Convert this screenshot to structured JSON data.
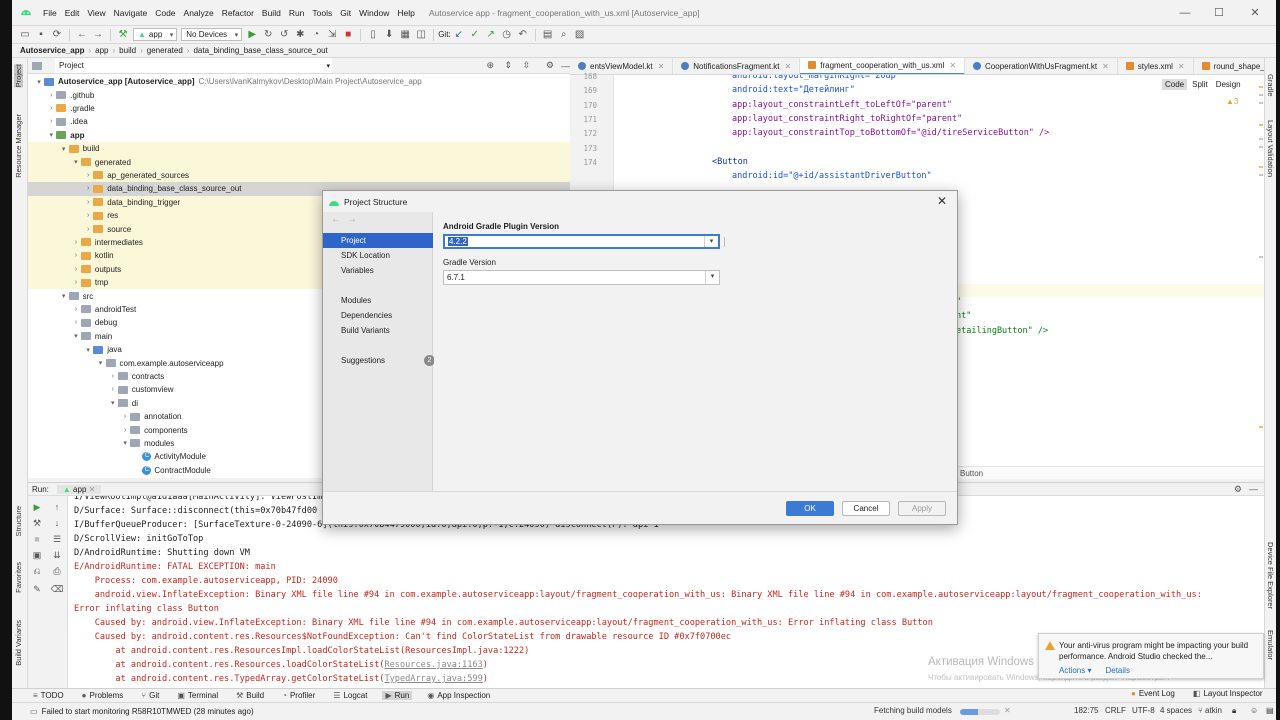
{
  "window": {
    "title": "Autoservice app - fragment_cooperation_with_us.xml [Autoservice_app]",
    "menu": [
      "File",
      "Edit",
      "View",
      "Navigate",
      "Code",
      "Analyze",
      "Refactor",
      "Build",
      "Run",
      "Tools",
      "Git",
      "Window",
      "Help"
    ]
  },
  "toolbar": {
    "run_config": "app",
    "device": "No Devices",
    "git_label": "Git:"
  },
  "breadcrumb": [
    "Autoservice_app",
    "app",
    "build",
    "generated",
    "data_binding_base_class_source_out"
  ],
  "left_strip": {
    "tabs": [
      "Project",
      "Resource Manager",
      "Structure",
      "Favorites",
      "Build Variants"
    ]
  },
  "right_strip": {
    "tabs": [
      "Gradle",
      "Layout Validation",
      "Device File Explorer",
      "Emulator"
    ]
  },
  "project": {
    "view_selector": "Project",
    "tree": [
      {
        "label": "Autoservice_app [Autoservice_app]",
        "path": "C:\\Users\\IvanKalmykov\\Desktop\\Main Project\\Autoservice_app",
        "depth": 0,
        "arrow": "▾",
        "icon": "blue",
        "bold": true
      },
      {
        "label": ".github",
        "depth": 1,
        "arrow": "›",
        "icon": "grey"
      },
      {
        "label": ".gradle",
        "depth": 1,
        "arrow": "›",
        "icon": "orange"
      },
      {
        "label": ".idea",
        "depth": 1,
        "arrow": "›",
        "icon": "grey"
      },
      {
        "label": "app",
        "depth": 1,
        "arrow": "▾",
        "icon": "green",
        "bold": true
      },
      {
        "label": "build",
        "depth": 2,
        "arrow": "▾",
        "icon": "orange",
        "gen": true
      },
      {
        "label": "generated",
        "depth": 3,
        "arrow": "▾",
        "icon": "orange",
        "gen": true
      },
      {
        "label": "ap_generated_sources",
        "depth": 4,
        "arrow": "›",
        "icon": "orange",
        "gen": true
      },
      {
        "label": "data_binding_base_class_source_out",
        "depth": 4,
        "arrow": "›",
        "icon": "orange",
        "gen": true,
        "selected": true
      },
      {
        "label": "data_binding_trigger",
        "depth": 4,
        "arrow": "›",
        "icon": "orange",
        "gen": true
      },
      {
        "label": "res",
        "depth": 4,
        "arrow": "›",
        "icon": "orange",
        "gen": true
      },
      {
        "label": "source",
        "depth": 4,
        "arrow": "›",
        "icon": "orange",
        "gen": true
      },
      {
        "label": "intermediates",
        "depth": 3,
        "arrow": "›",
        "icon": "orange",
        "gen": true
      },
      {
        "label": "kotlin",
        "depth": 3,
        "arrow": "›",
        "icon": "orange",
        "gen": true
      },
      {
        "label": "outputs",
        "depth": 3,
        "arrow": "›",
        "icon": "orange",
        "gen": true
      },
      {
        "label": "tmp",
        "depth": 3,
        "arrow": "›",
        "icon": "orange",
        "gen": true
      },
      {
        "label": "src",
        "depth": 2,
        "arrow": "▾",
        "icon": "grey"
      },
      {
        "label": "androidTest",
        "depth": 3,
        "arrow": "›",
        "icon": "grey"
      },
      {
        "label": "debug",
        "depth": 3,
        "arrow": "›",
        "icon": "grey"
      },
      {
        "label": "main",
        "depth": 3,
        "arrow": "▾",
        "icon": "grey"
      },
      {
        "label": "java",
        "depth": 4,
        "arrow": "▾",
        "icon": "blue"
      },
      {
        "label": "com.example.autoserviceapp",
        "depth": 5,
        "arrow": "▾",
        "icon": "grey"
      },
      {
        "label": "contracts",
        "depth": 6,
        "arrow": "›",
        "icon": "grey"
      },
      {
        "label": "customview",
        "depth": 6,
        "arrow": "›",
        "icon": "grey"
      },
      {
        "label": "di",
        "depth": 6,
        "arrow": "▾",
        "icon": "grey"
      },
      {
        "label": "annotation",
        "depth": 7,
        "arrow": "›",
        "icon": "grey"
      },
      {
        "label": "components",
        "depth": 7,
        "arrow": "›",
        "icon": "grey"
      },
      {
        "label": "modules",
        "depth": 7,
        "arrow": "▾",
        "icon": "grey"
      },
      {
        "label": "ActivityModule",
        "depth": 8,
        "arrow": "",
        "icon": "class"
      },
      {
        "label": "ContractModule",
        "depth": 8,
        "arrow": "",
        "icon": "class"
      }
    ]
  },
  "editor": {
    "tabs": [
      {
        "label": "entsViewModel.kt",
        "type": "kt"
      },
      {
        "label": "NotificationsFragment.kt",
        "type": "kt"
      },
      {
        "label": "fragment_cooperation_with_us.xml",
        "type": "xml",
        "active": true
      },
      {
        "label": "CooperationWithUsFragment.kt",
        "type": "kt"
      },
      {
        "label": "styles.xml",
        "type": "xml"
      },
      {
        "label": "round_shape_cooperatic",
        "type": "xml"
      }
    ],
    "view_modes": [
      "Code",
      "Split",
      "Design"
    ],
    "warnings": "▲3",
    "line_numbers": [
      "168",
      "169",
      "170",
      "171",
      "172",
      "173",
      "174"
    ],
    "code_lines": [
      "android:layout_marginRight=\"20dp\"",
      "android:text=\"Детейлинг\"",
      "app:layout_constraintLeft_toLeftOf=\"parent\"",
      "app:layout_constraintRight_toRightOf=\"parent\"",
      "app:layout_constraintTop_toBottomOf=\"@id/tireServiceButton\" />",
      "",
      "<Button",
      "android:id=\"@+id/assistantDriverButton\""
    ],
    "right_fragments": [
      "\"",
      "nt\"",
      "etailingButton\" />"
    ],
    "bottom_crumb": "Button"
  },
  "run": {
    "label": "Run:",
    "tab": "app",
    "lines": [
      {
        "t": "I/ViewRootImpl@a1d1aaa[MainActivity]: ViewPostIme",
        "err": false
      },
      {
        "t": "D/Surface: Surface::disconnect(this=0x70b47fd00",
        "err": false
      },
      {
        "t": "I/BufferQueueProducer: [SurfaceTexture-0-24090-6](this:0x70b4479000,id:6,api:0,p:-1,c:24090) disconnect(P): api 1",
        "err": false
      },
      {
        "t": "D/ScrollView: initGoToTop",
        "err": false
      },
      {
        "t": "D/AndroidRuntime: Shutting down VM",
        "err": false
      },
      {
        "t": "E/AndroidRuntime: FATAL EXCEPTION: main",
        "err": true
      },
      {
        "t": "    Process: com.example.autoserviceapp, PID: 24090",
        "err": true
      },
      {
        "t": "    android.view.InflateException: Binary XML file line #94 in com.example.autoserviceapp:layout/fragment_cooperation_with_us: Binary XML file line #94 in com.example.autoserviceapp:layout/fragment_cooperation_with_us:",
        "err": true
      },
      {
        "t": "Error inflating class Button",
        "err": true
      },
      {
        "t": "    Caused by: android.view.InflateException: Binary XML file line #94 in com.example.autoserviceapp:layout/fragment_cooperation_with_us: Error inflating class Button",
        "err": true
      },
      {
        "t": "    Caused by: android.content.res.Resources$NotFoundException: Can't find ColorStateList from drawable resource ID #0x7f0700ec",
        "err": true
      },
      {
        "t": "        at android.content.res.ResourcesImpl.loadColorStateList(ResourcesImpl.java:1222)",
        "err": true
      },
      {
        "t": "        at android.content.res.Resources.loadColorStateList(",
        "link": "Resources.java:1163",
        "after": ")",
        "err": true
      },
      {
        "t": "        at android.content.res.TypedArray.getColorStateList(",
        "link": "TypedArray.java:599",
        "after": ")",
        "err": true
      }
    ]
  },
  "bottom_tools": [
    {
      "label": "TODO",
      "icon": "≡"
    },
    {
      "label": "Problems",
      "icon": "●"
    },
    {
      "label": "Git",
      "icon": "⑂"
    },
    {
      "label": "Terminal",
      "icon": "▣"
    },
    {
      "label": "Build",
      "icon": "⚒"
    },
    {
      "label": "Profiler",
      "icon": "◔"
    },
    {
      "label": "Logcat",
      "icon": "☰"
    },
    {
      "label": "Run",
      "icon": "▶",
      "active": true
    },
    {
      "label": "App Inspection",
      "icon": "◉"
    }
  ],
  "bottom_right_tools": [
    {
      "label": "Event Log",
      "icon": "●"
    },
    {
      "label": "Layout Inspector",
      "icon": "◧"
    }
  ],
  "status": {
    "message": "Failed to start monitoring R58R10TMWED (28 minutes ago)",
    "task": "Fetching build models",
    "position": "182:75",
    "line_sep": "CRLF",
    "encoding": "UTF-8",
    "indent": "4 spaces",
    "vcs": "atkin"
  },
  "notification": {
    "text": "Your anti-virus program might be impacting your build performance. Android Studio checked the...",
    "actions": [
      "Actions ▾",
      "Details"
    ]
  },
  "watermark": {
    "line1": "Активация Windows",
    "line2": "Чтобы активировать Windows, перейдите в раздел \"Параметры\"."
  },
  "dialog": {
    "title": "Project Structure",
    "nav": [
      {
        "label": "Project",
        "selected": true
      },
      {
        "label": "SDK Location"
      },
      {
        "label": "Variables"
      },
      {
        "label": "Modules"
      },
      {
        "label": "Dependencies"
      },
      {
        "label": "Build Variants"
      },
      {
        "label": "Suggestions",
        "badge": "2"
      }
    ],
    "agp_label": "Android Gradle Plugin Version",
    "agp_value": "4.2.2",
    "gradle_label": "Gradle Version",
    "gradle_value": "6.7.1",
    "buttons": {
      "ok": "OK",
      "cancel": "Cancel",
      "apply": "Apply"
    }
  },
  "colors": {
    "selection_blue": "#2f65ca",
    "primary_button": "#3d7ad3",
    "error_red": "#c4281e",
    "generated_bg": "#fbf7d9"
  }
}
